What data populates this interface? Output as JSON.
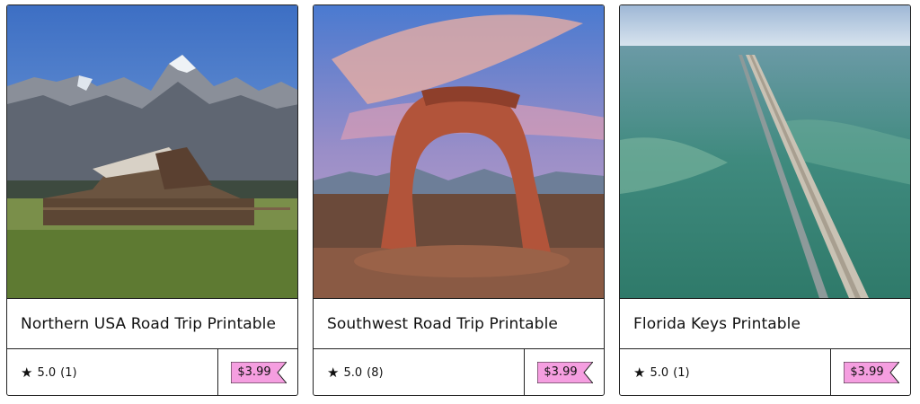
{
  "products": [
    {
      "title": "Northern USA Road Trip Printable",
      "rating": "5.0",
      "reviews": "(1)",
      "price": "$3.99",
      "image_icon": "barn-mountains-photo"
    },
    {
      "title": "Southwest Road Trip Printable",
      "rating": "5.0",
      "reviews": "(8)",
      "price": "$3.99",
      "image_icon": "arch-desert-photo"
    },
    {
      "title": "Florida Keys Printable",
      "rating": "5.0",
      "reviews": "(1)",
      "price": "$3.99",
      "image_icon": "bridge-ocean-photo"
    }
  ],
  "colors": {
    "price_tag": "#f59ee0",
    "border": "#222222"
  }
}
